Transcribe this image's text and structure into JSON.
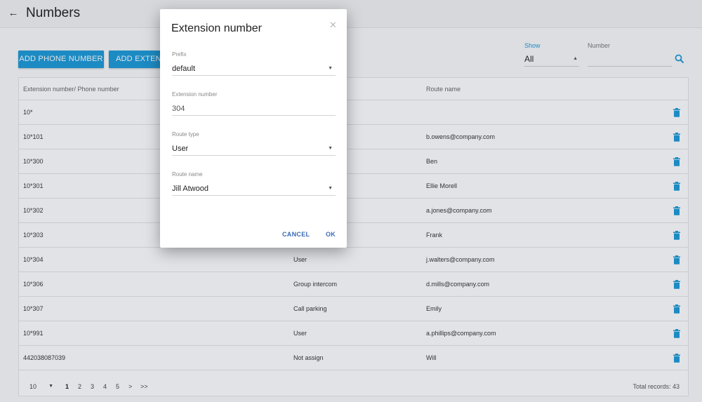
{
  "header": {
    "title": "Numbers",
    "back_icon": "arrow-left-icon"
  },
  "toolbar": {
    "add_phone_label": "ADD PHONE NUMBER",
    "add_extension_label": "ADD EXTENSIO"
  },
  "filters": {
    "show_label": "Show",
    "show_value": "All",
    "number_label": "Number",
    "number_value": "",
    "search_icon": "search-icon"
  },
  "table": {
    "columns": [
      "Extension number/ Phone number",
      "",
      "Route name"
    ],
    "rows": [
      {
        "number": "10*",
        "type": "",
        "route": ""
      },
      {
        "number": "10*101",
        "type": "",
        "route": "b.owens@company.com"
      },
      {
        "number": "10*300",
        "type": "",
        "route": "Ben"
      },
      {
        "number": "10*301",
        "type": "",
        "route": "Ellie Morell"
      },
      {
        "number": "10*302",
        "type": "",
        "route": "a.jones@company.com"
      },
      {
        "number": "10*303",
        "type": "",
        "route": "Frank"
      },
      {
        "number": "10*304",
        "type": "User",
        "route": "j.walters@company.com"
      },
      {
        "number": "10*306",
        "type": "Group intercom",
        "route": "d.mills@company.com"
      },
      {
        "number": "10*307",
        "type": "Call parking",
        "route": "Emily"
      },
      {
        "number": "10*991",
        "type": "User",
        "route": "a.phillips@company.com"
      },
      {
        "number": "442038087039",
        "type": "Not assign",
        "route": "Will"
      }
    ]
  },
  "pagination": {
    "page_size": "10",
    "pages": [
      "1",
      "2",
      "3",
      "4",
      "5"
    ],
    "current_page": "1",
    "next": ">",
    "last": ">>",
    "total": "Total records: 43"
  },
  "dialog": {
    "title": "Extension number",
    "close_icon": "close-icon",
    "prefix_label": "Prefix",
    "prefix_value": "default",
    "extension_label": "Extension number",
    "extension_value": "304",
    "route_type_label": "Route type",
    "route_type_value": "User",
    "route_name_label": "Route name",
    "route_name_value": "Jill Atwood",
    "cancel_label": "CANCEL",
    "ok_label": "OK"
  },
  "colors": {
    "accent": "#1d9ad6",
    "dialog_button": "#3b6ab5"
  }
}
